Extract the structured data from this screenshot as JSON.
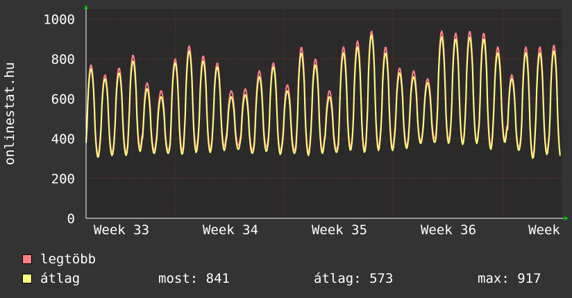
{
  "chart_data": {
    "type": "line",
    "ylabel": "onlinestat.hu",
    "ylim": [
      0,
      1050
    ],
    "yticks": [
      0,
      200,
      400,
      600,
      800,
      1000
    ],
    "xticks": [
      "Week 33",
      "Week 34",
      "Week 35",
      "Week 36",
      "Week"
    ],
    "grid": true,
    "series": [
      {
        "name": "legtöbb",
        "color": "#ff7f84",
        "peaks": [
          770,
          720,
          755,
          820,
          680,
          640,
          800,
          865,
          815,
          780,
          640,
          650,
          740,
          780,
          670,
          860,
          800,
          640,
          860,
          890,
          940,
          860,
          755,
          740,
          700,
          940,
          930,
          940,
          930,
          860,
          720,
          860,
          860,
          870
        ],
        "troughs": [
          320,
          330,
          330,
          355,
          340,
          340,
          340,
          350,
          345,
          360,
          365,
          340,
          355,
          335,
          340,
          330,
          340,
          345,
          355,
          345,
          355,
          355,
          365,
          385,
          400,
          390,
          380,
          385,
          360,
          395,
          355,
          315,
          335,
          310
        ]
      },
      {
        "name": "átlag",
        "color": "#ffff80",
        "peaks": [
          750,
          700,
          730,
          790,
          650,
          610,
          780,
          840,
          790,
          760,
          610,
          620,
          710,
          760,
          640,
          830,
          770,
          610,
          830,
          860,
          920,
          830,
          730,
          710,
          680,
          910,
          900,
          910,
          900,
          830,
          700,
          830,
          830,
          841
        ],
        "troughs": [
          305,
          315,
          315,
          335,
          325,
          325,
          320,
          330,
          330,
          340,
          345,
          325,
          335,
          320,
          325,
          315,
          325,
          330,
          340,
          330,
          340,
          340,
          350,
          375,
          380,
          375,
          370,
          375,
          345,
          380,
          340,
          300,
          320,
          300
        ]
      }
    ]
  },
  "legend": {
    "max_label": "legtöbb",
    "avg_label": "átlag"
  },
  "stats": {
    "current": "most: 841",
    "average": "átlag: 573",
    "maximum": "max: 917"
  },
  "colors": {
    "background": "#333333",
    "plot_background": "#2a2a2a",
    "grid_major": "#6a3030",
    "grid_minor": "#4a2a2a",
    "axis": "#ffffff",
    "arrow": "#00cc00"
  }
}
